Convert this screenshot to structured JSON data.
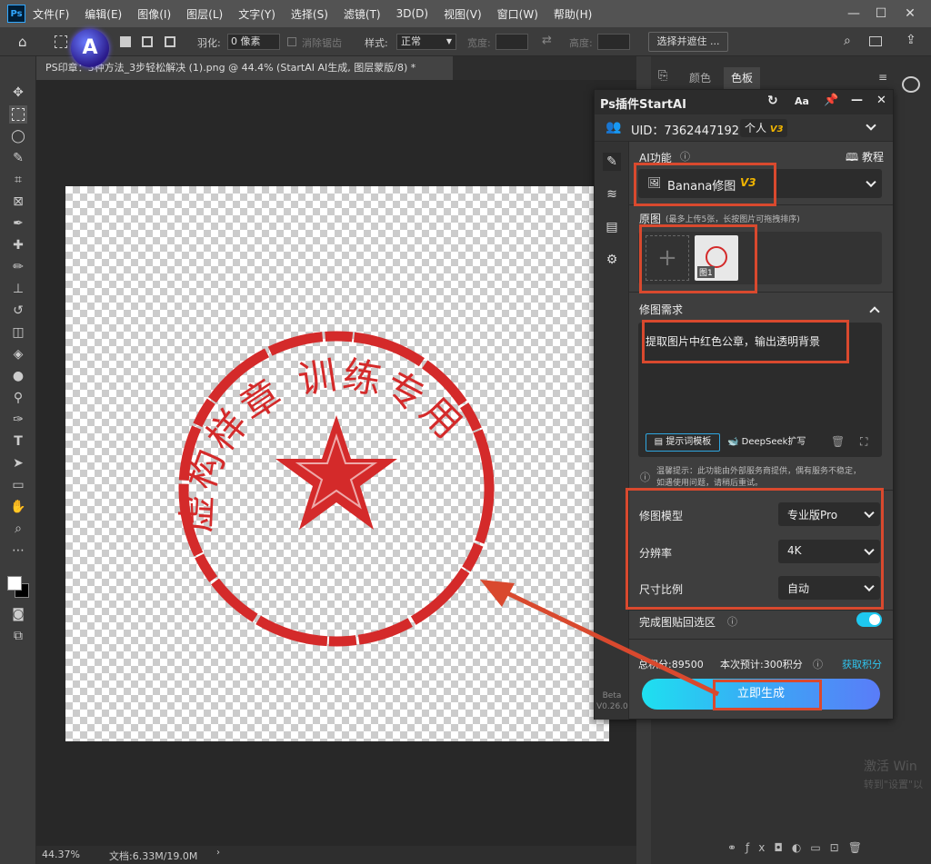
{
  "menubar": {
    "app_icon": "Ps",
    "items": [
      "文件(F)",
      "编辑(E)",
      "图像(I)",
      "图层(L)",
      "文字(Y)",
      "选择(S)",
      "滤镜(T)",
      "3D(D)",
      "视图(V)",
      "窗口(W)",
      "帮助(H)"
    ]
  },
  "options": {
    "feather_label": "羽化:",
    "feather_value": "0 像素",
    "antialias_label": "消除锯齿",
    "style_label": "样式:",
    "style_value": "正常",
    "width_label": "宽度:",
    "height_label": "高度:",
    "select_mask_button": "选择并遮住 ..."
  },
  "document": {
    "tab_title": "PS印章：3种方法_3步轻松解决 (1).png @ 44.4% (StartAI AI生成, 图层蒙版/8) *",
    "zoom": "44.37%",
    "doc_size": "文档:6.33M/19.0M"
  },
  "right_panel": {
    "tab_color": "颜色",
    "tab_swatches": "色板"
  },
  "stamp": {
    "top_text": "虚构样章 训练专用",
    "color": "#d42a2a"
  },
  "plugin": {
    "title": "Ps插件StartAI",
    "uid_label": "UID：7362447192",
    "account_type": "个人",
    "account_badge": "V3",
    "ai_function_label": "AI功能",
    "tutorial_label": "教程",
    "function_value": "Banana修图",
    "function_badge": "V3",
    "source_label": "原图",
    "source_hint": "(最多上传5张，长按图片可拖拽排序)",
    "thumb_label": "图1",
    "request_label": "修图需求",
    "request_text": "提取图片中红色公章，输出透明背景",
    "prompt_template_button": "提示词模板",
    "deepseek_button": "DeepSeek扩写",
    "notice_line1": "温馨提示：此功能由外部服务商提供，偶有服务不稳定，",
    "notice_line2": "如遇使用问题，请稍后重试。",
    "model_label": "修图模型",
    "model_value": "专业版Pro",
    "resolution_label": "分辨率",
    "resolution_value": "4K",
    "ratio_label": "尺寸比例",
    "ratio_value": "自动",
    "paste_back_label": "完成图贴回选区",
    "paste_back_on": true,
    "points_total": "总积分:89500",
    "points_cost": "本次预计:300积分",
    "get_points_link": "获取积分",
    "generate_button": "立即生成",
    "beta_label": "Beta",
    "version_label": "V0.26.0"
  },
  "watermark": {
    "line1": "激活 Win",
    "line2": "转到\"设置\"以"
  },
  "colors": {
    "accent_cyan": "#1ec8f0",
    "annotation_red": "#d9492e",
    "v3_badge": "#f0b400",
    "link_cyan": "#2fc6f0"
  }
}
